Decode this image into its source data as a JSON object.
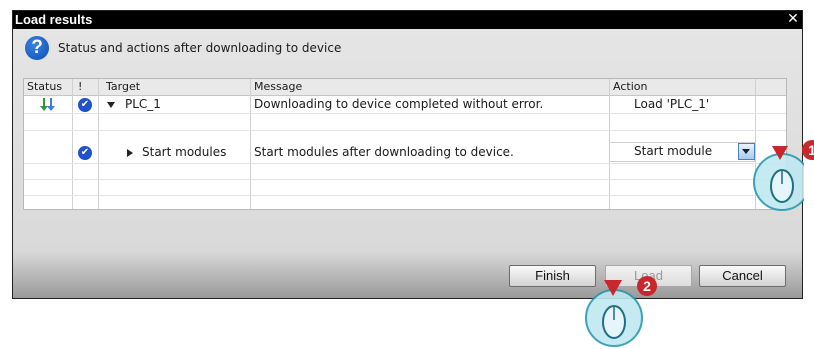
{
  "dialog": {
    "title": "Load results",
    "close_glyph": "✕",
    "header_text": "Status and actions after downloading to device",
    "question_glyph": "?"
  },
  "table": {
    "columns": [
      "Status",
      "!",
      "Target",
      "Message",
      "Action"
    ],
    "rows": [
      {
        "status_icon": "download-arrows-icon",
        "has_check": true,
        "expand": "expanded",
        "target": "PLC_1",
        "message": "Downloading to device completed without error.",
        "action": "Load 'PLC_1'"
      },
      {
        "status_icon": "",
        "has_check": true,
        "expand": "collapsed",
        "target": "Start modules",
        "message": "Start modules after downloading to device.",
        "action": "Start module"
      }
    ]
  },
  "buttons": {
    "finish": "Finish",
    "load": "Load",
    "cancel": "Cancel"
  },
  "annotations": {
    "step_1": "1",
    "step_2": "2"
  },
  "colors": {
    "title_bar": "#000000",
    "check_blue": "#1e52c9",
    "status_green": "#2e9a3c",
    "badge_red": "#c8272d"
  }
}
